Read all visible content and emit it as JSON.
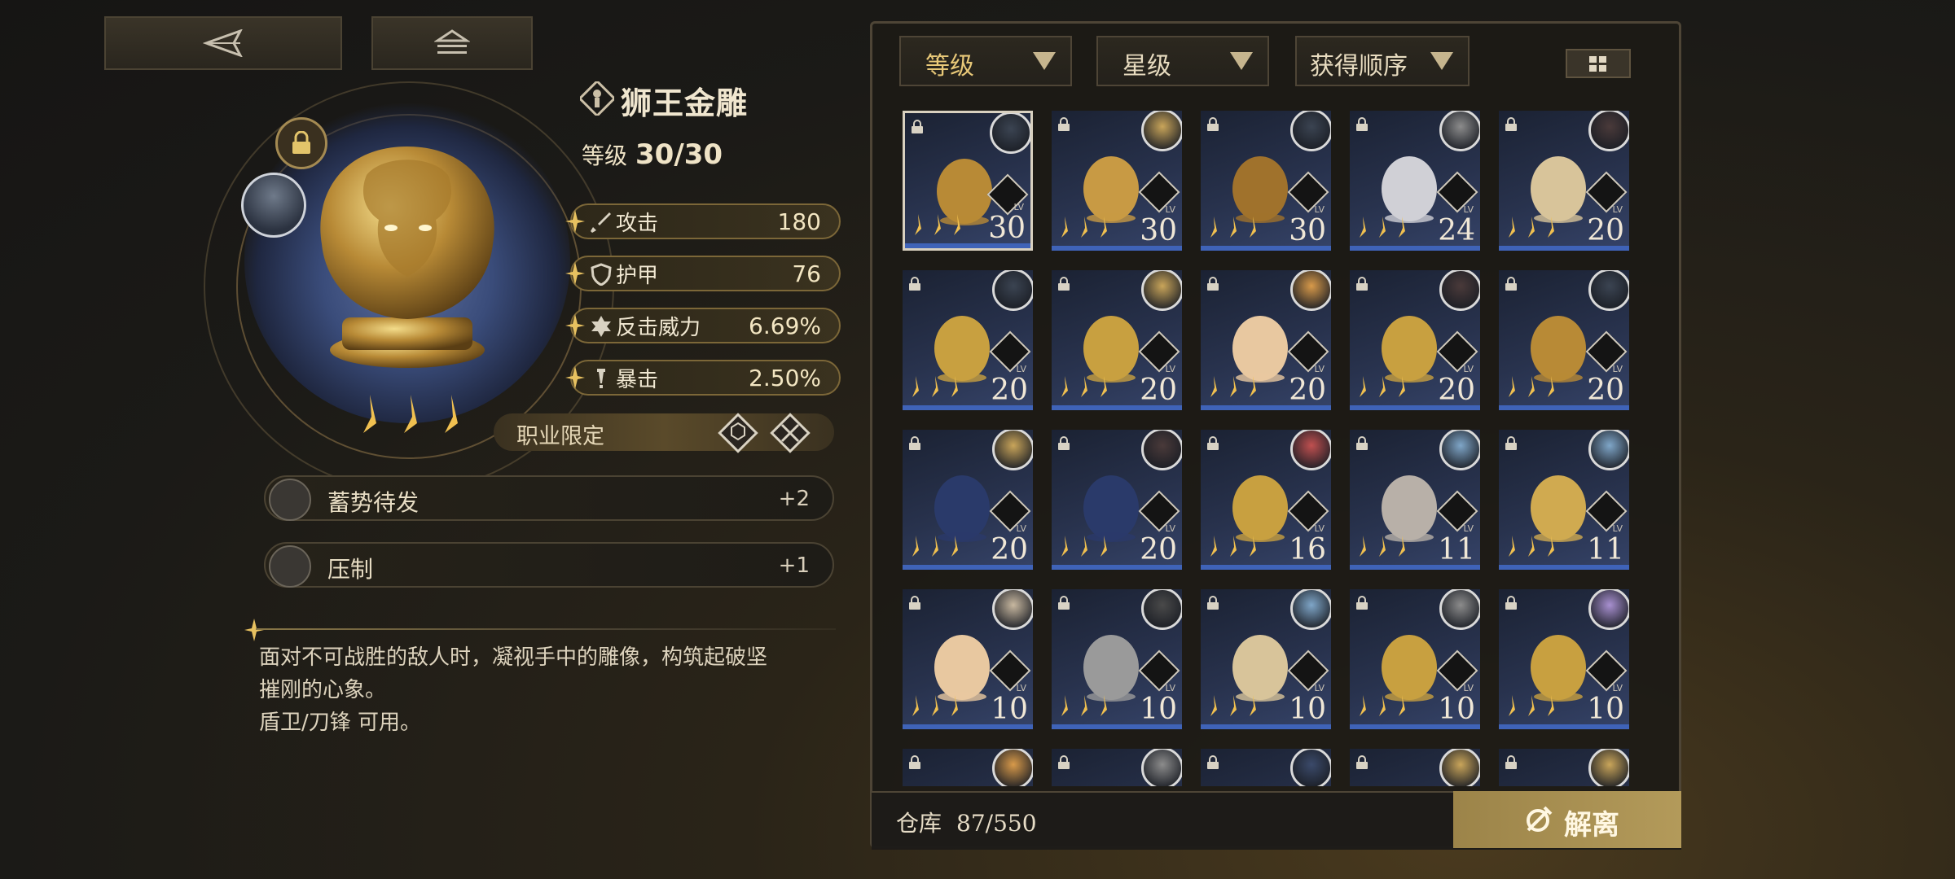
{
  "item": {
    "name": "狮王金雕",
    "level_label": "等级",
    "level_value": "30/30",
    "stars": 3,
    "stats": [
      {
        "label": "攻击",
        "value": "180",
        "icon": "sword-icon"
      },
      {
        "label": "护甲",
        "value": "76",
        "icon": "shield-icon"
      },
      {
        "label": "反击威力",
        "value": "6.69%",
        "icon": "counter-icon"
      },
      {
        "label": "暴击",
        "value": "2.50%",
        "icon": "crit-icon"
      }
    ],
    "job_restriction_label": "职业限定",
    "skills": [
      {
        "label": "蓄势待发",
        "value": "+2"
      },
      {
        "label": "压制",
        "value": "+1"
      }
    ],
    "description_lines": [
      "面对不可战胜的敌人时，凝视手中的雕像，构筑起破坚",
      "摧刚的心象。",
      "盾卫/刀锋 可用。"
    ]
  },
  "filters": [
    {
      "label": "等级"
    },
    {
      "label": "星级"
    },
    {
      "label": "获得顺序"
    }
  ],
  "grid": [
    {
      "level": "30",
      "art": "lion"
    },
    {
      "level": "30",
      "art": "wings"
    },
    {
      "level": "30",
      "art": "book"
    },
    {
      "level": "24",
      "art": "nutcracker"
    },
    {
      "level": "20",
      "art": "mannequin"
    },
    {
      "level": "20",
      "art": "key-red"
    },
    {
      "level": "20",
      "art": "key-blue"
    },
    {
      "level": "20",
      "art": "scroll"
    },
    {
      "level": "20",
      "art": "key-blue"
    },
    {
      "level": "20",
      "art": "lion"
    },
    {
      "level": "20",
      "art": "card"
    },
    {
      "level": "20",
      "art": "card"
    },
    {
      "level": "16",
      "art": "key-red"
    },
    {
      "level": "11",
      "art": "photo"
    },
    {
      "level": "11",
      "art": "key-plain"
    },
    {
      "level": "10",
      "art": "scroll"
    },
    {
      "level": "10",
      "art": "fan"
    },
    {
      "level": "10",
      "art": "mannequin"
    },
    {
      "level": "10",
      "art": "key-green"
    },
    {
      "level": "10",
      "art": "key-green"
    },
    {
      "level": "",
      "art": "partial"
    },
    {
      "level": "",
      "art": "partial"
    },
    {
      "level": "",
      "art": "partial"
    },
    {
      "level": "",
      "art": "partial"
    },
    {
      "level": "",
      "art": "partial"
    }
  ],
  "grid_lv_label": "LV",
  "storage": {
    "label": "仓库",
    "value": "87/550"
  },
  "dismantle_label": "解离",
  "colors": {
    "accent": "#b39a5a",
    "selected_border": "#d8d0bf",
    "level_bar": "#3f63b8"
  }
}
